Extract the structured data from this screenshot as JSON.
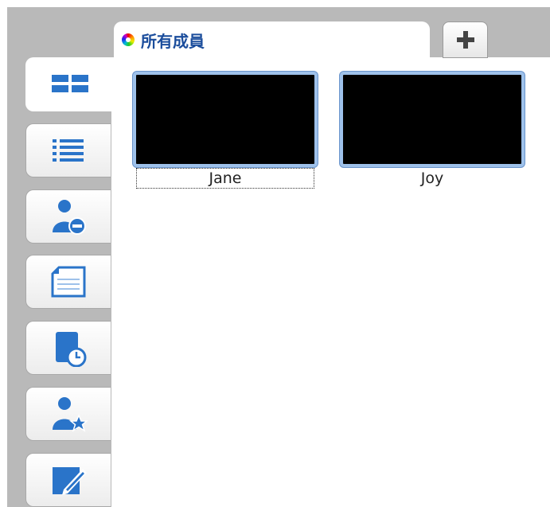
{
  "tabs": {
    "active_label": "所有成員",
    "add_label": "+"
  },
  "sidebar": {
    "buttons": [
      {
        "name": "grid-view",
        "icon": "grid-icon"
      },
      {
        "name": "list-view",
        "icon": "list-icon"
      },
      {
        "name": "remove-member",
        "icon": "user-minus-icon"
      },
      {
        "name": "document",
        "icon": "document-icon"
      },
      {
        "name": "history",
        "icon": "document-clock-icon"
      },
      {
        "name": "favorite-member",
        "icon": "user-star-icon"
      },
      {
        "name": "edit",
        "icon": "edit-icon"
      }
    ]
  },
  "members": [
    {
      "name": "Jane",
      "selected": true
    },
    {
      "name": "Joy",
      "selected": false
    }
  ],
  "colors": {
    "accent": "#1b4d9c",
    "icon_blue": "#2a74c9",
    "chrome_gray": "#b9b9b9",
    "thumb_border": "#9ec1ea"
  }
}
